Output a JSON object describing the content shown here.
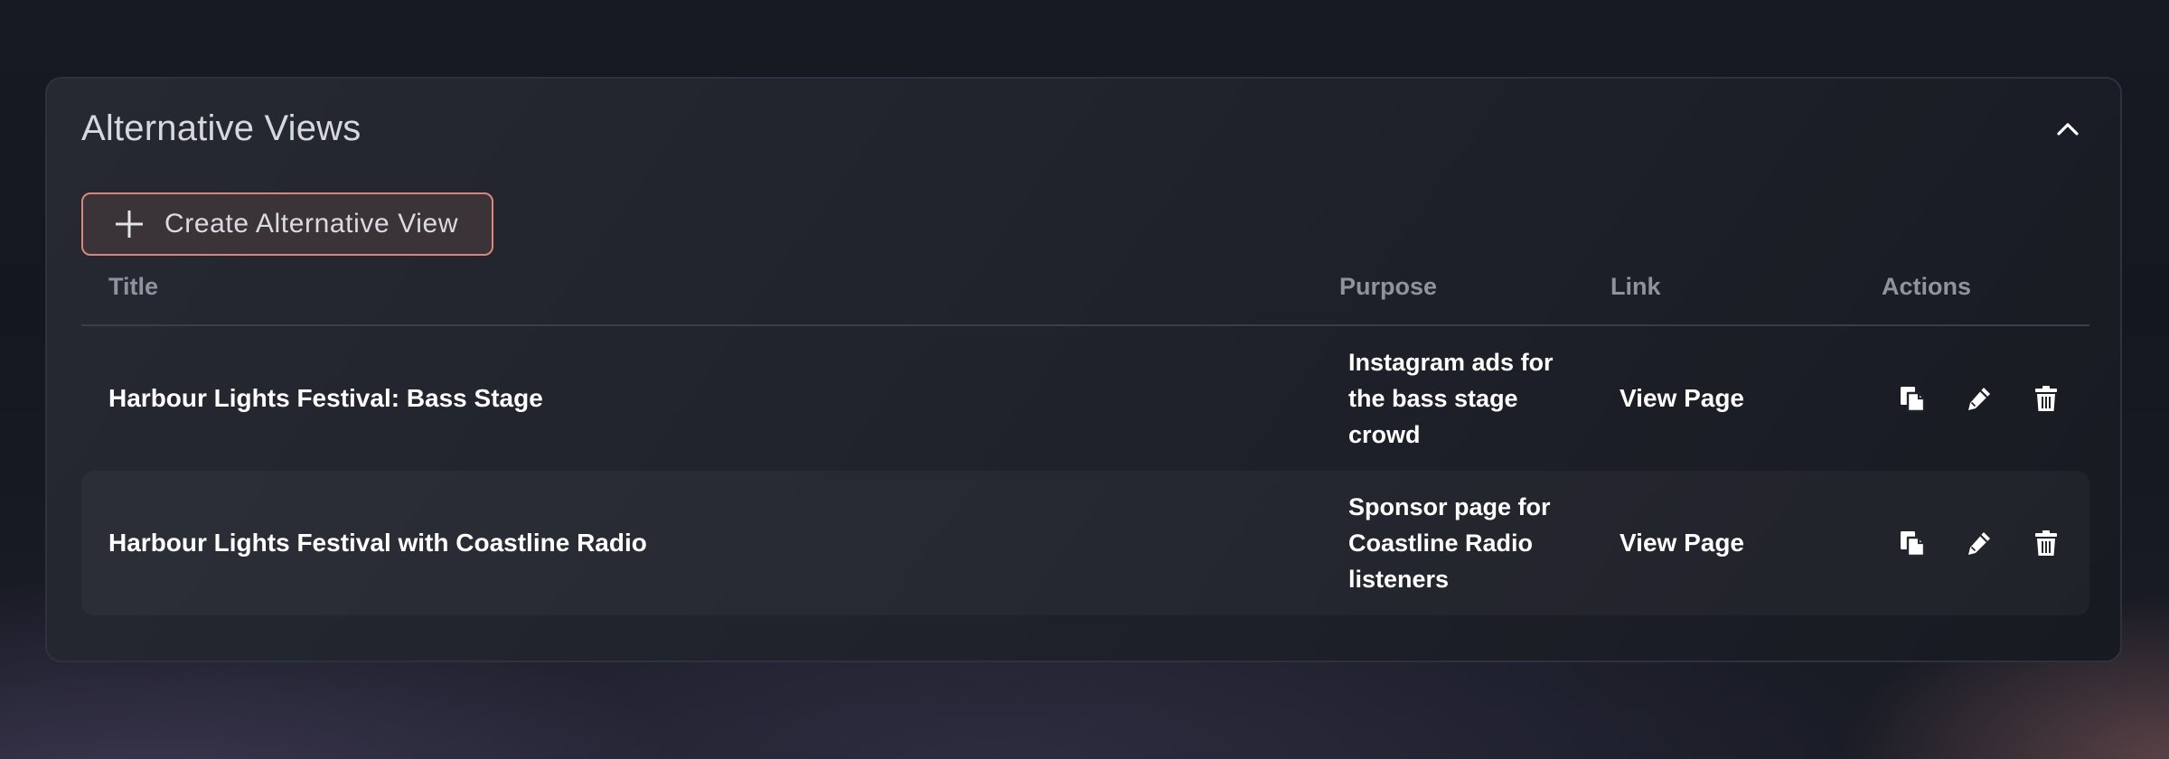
{
  "panel": {
    "title": "Alternative Views",
    "collapse_icon": "chevron-up-icon"
  },
  "create_button": {
    "label": "Create Alternative View",
    "icon": "plus-icon",
    "border_color": "#d9877d"
  },
  "table": {
    "columns": {
      "title": "Title",
      "purpose": "Purpose",
      "link": "Link",
      "actions": "Actions"
    },
    "rows": [
      {
        "title": "Harbour Lights Festival: Bass Stage",
        "purpose": "Instagram ads for the bass stage crowd",
        "link": "View Page",
        "actions": [
          "copy-icon",
          "edit-icon",
          "trash-icon"
        ]
      },
      {
        "title": "Harbour Lights Festival with Coastline Radio",
        "purpose": "Sponsor page for Coastline Radio listeners",
        "link": "View Page",
        "actions": [
          "copy-icon",
          "edit-icon",
          "trash-icon"
        ]
      }
    ]
  }
}
